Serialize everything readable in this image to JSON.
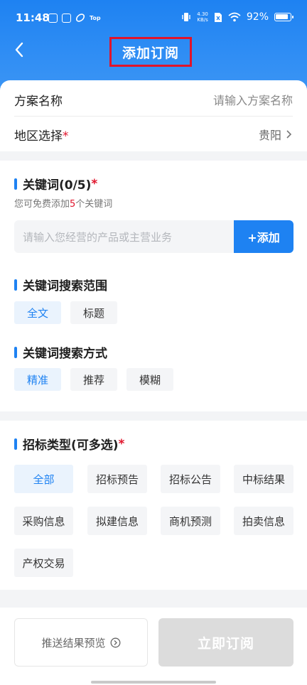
{
  "status_bar": {
    "time": "11:48",
    "top_label": "Top",
    "net_speed_top": "4.30",
    "net_speed_bottom": "KB/s",
    "battery": "92%"
  },
  "header": {
    "title": "添加订阅"
  },
  "form": {
    "plan_name_label": "方案名称",
    "plan_name_placeholder": "请输入方案名称",
    "region_label": "地区选择",
    "region_required": "*",
    "region_value": "贵阳"
  },
  "keywords": {
    "title": "关键词(0/5)",
    "required": "*",
    "hint_prefix": "您可免费添加",
    "hint_count": "5",
    "hint_suffix": "个关键词",
    "input_placeholder": "请输入您经营的产品或主营业务",
    "add_label": "+添加"
  },
  "search_scope": {
    "title": "关键词搜索范围",
    "options": [
      "全文",
      "标题"
    ],
    "selected": "全文"
  },
  "search_mode": {
    "title": "关键词搜索方式",
    "options": [
      "精准",
      "推荐",
      "模糊"
    ],
    "selected": "精准"
  },
  "bid_types": {
    "title": "招标类型(可多选)",
    "required": "*",
    "options": [
      "全部",
      "招标预告",
      "招标公告",
      "中标结果",
      "采购信息",
      "拟建信息",
      "商机预测",
      "拍卖信息",
      "产权交易"
    ],
    "selected": "全部"
  },
  "footer": {
    "preview_label": "推送结果预览",
    "subscribe_label": "立即订阅"
  },
  "colors": {
    "primary": "#1e82f2",
    "required": "#e0142b",
    "disabled": "#dcdcdc"
  }
}
